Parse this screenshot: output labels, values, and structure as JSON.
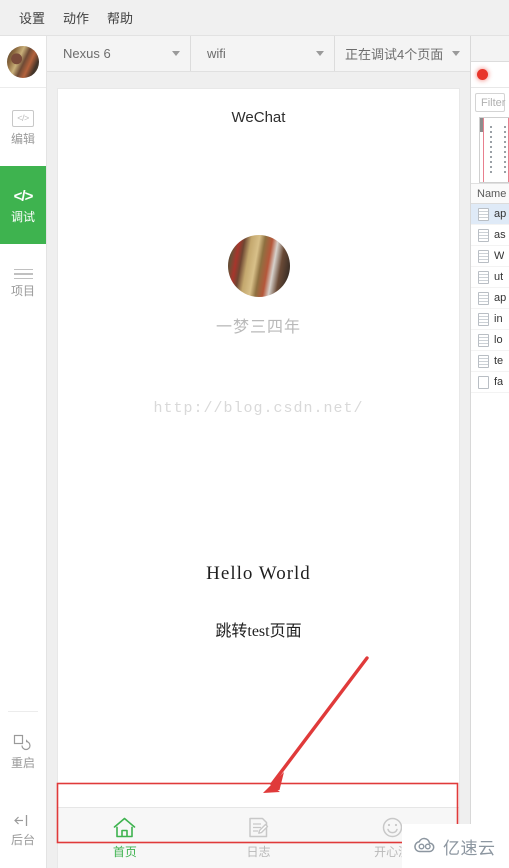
{
  "menubar": {
    "items": [
      {
        "label": "设置",
        "name": "menu-settings"
      },
      {
        "label": "动作",
        "name": "menu-actions"
      },
      {
        "label": "帮助",
        "name": "menu-help"
      }
    ]
  },
  "sidebar": {
    "avatar_name": "user-avatar",
    "items": [
      {
        "label": "编辑",
        "icon": "code-box-icon",
        "active": false
      },
      {
        "label": "调试",
        "icon": "code-brackets-icon",
        "active": true
      },
      {
        "label": "项目",
        "icon": "list-lines-icon",
        "active": false
      }
    ],
    "bottom_items": [
      {
        "label": "重启",
        "icon": "restart-icon"
      },
      {
        "label": "后台",
        "icon": "background-icon"
      }
    ]
  },
  "toolbar": {
    "device": "Nexus 6",
    "network": "wifi",
    "debug_status": "正在调试4个页面",
    "inspect_icon": "cursor-inspect-icon"
  },
  "simulator": {
    "title": "WeChat",
    "user_name": "一梦三四年",
    "blog_url": "http://blog.csdn.net/",
    "hello_text": "Hello World",
    "jump_link": "跳转test页面",
    "tabs": [
      {
        "label": "首页",
        "icon": "home-icon",
        "active": true
      },
      {
        "label": "日志",
        "icon": "note-edit-icon",
        "active": false
      },
      {
        "label": "开心测",
        "icon": "smiley-icon",
        "active": false
      }
    ]
  },
  "devtools": {
    "record_button": "record-button",
    "filter_placeholder": "Filter",
    "column_header": "Name",
    "rows": [
      {
        "name": "ap",
        "icon": "file-icon",
        "selected": true
      },
      {
        "name": "as",
        "icon": "file-icon",
        "selected": false
      },
      {
        "name": "W",
        "icon": "file-icon",
        "selected": false
      },
      {
        "name": "ut",
        "icon": "file-icon",
        "selected": false
      },
      {
        "name": "ap",
        "icon": "file-icon",
        "selected": false
      },
      {
        "name": "in",
        "icon": "file-icon",
        "selected": false
      },
      {
        "name": "lo",
        "icon": "file-icon",
        "selected": false
      },
      {
        "name": "te",
        "icon": "file-icon",
        "selected": false
      },
      {
        "name": "fa",
        "icon": "file-blank-icon",
        "selected": false
      }
    ]
  },
  "annotation": {
    "highlight_color": "#e03a3a",
    "arrow_name": "red-arrow-annotation",
    "box_name": "red-highlight-box"
  },
  "watermark": {
    "text": "亿速云",
    "icon": "cloud-icon"
  },
  "colors": {
    "accent_green": "#3eb34f",
    "annotation_red": "#e03a3a",
    "record_red": "#e8352a"
  }
}
